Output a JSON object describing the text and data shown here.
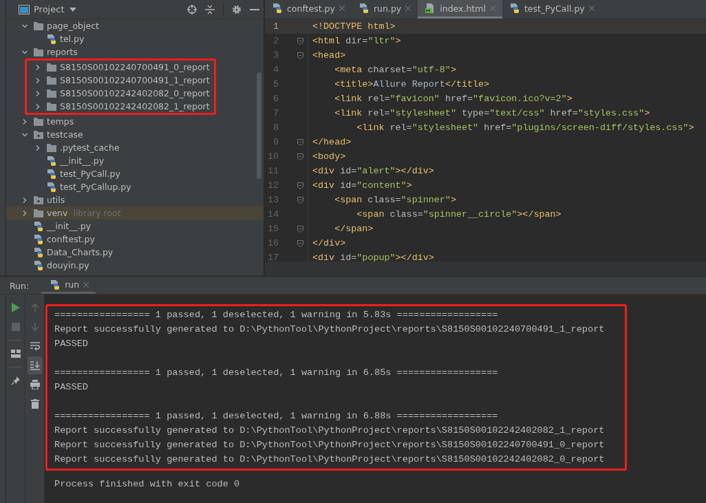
{
  "project_panel": {
    "title": "Project",
    "tree": [
      {
        "name": "page_object",
        "kind": "folder",
        "expanded": true,
        "selected": false,
        "children": [
          {
            "name": "tel.py",
            "kind": "python",
            "selected": false
          }
        ]
      },
      {
        "name": "reports",
        "kind": "folder",
        "expanded": true,
        "selected": false,
        "highlighted": true,
        "children": [
          {
            "name": "S8150S00102240700491_0_report",
            "kind": "folder",
            "expanded": false,
            "selected": false
          },
          {
            "name": "S8150S00102240700491_1_report",
            "kind": "folder",
            "expanded": false,
            "selected": false
          },
          {
            "name": "S8150S00102242402082_0_report",
            "kind": "folder",
            "expanded": false,
            "selected": false
          },
          {
            "name": "S8150S00102242402082_1_report",
            "kind": "folder",
            "expanded": false,
            "selected": false
          }
        ]
      },
      {
        "name": "temps",
        "kind": "folder",
        "expanded": false,
        "selected": false
      },
      {
        "name": "testcase",
        "kind": "package",
        "expanded": true,
        "selected": false,
        "children": [
          {
            "name": ".pytest_cache",
            "kind": "folder",
            "expanded": false,
            "selected": false
          },
          {
            "name": "__init__.py",
            "kind": "python",
            "selected": false
          },
          {
            "name": "test_PyCall.py",
            "kind": "python",
            "selected": false
          },
          {
            "name": "test_PyCallup.py",
            "kind": "python",
            "selected": false
          }
        ]
      },
      {
        "name": "utils",
        "kind": "package",
        "expanded": false,
        "selected": false
      },
      {
        "name": "venv",
        "kind": "folder",
        "expanded": false,
        "selected": true,
        "suffix": "library root"
      },
      {
        "name": "__init__.py",
        "kind": "python",
        "selected": false
      },
      {
        "name": "conftest.py",
        "kind": "python",
        "selected": false
      },
      {
        "name": "Data_Charts.py",
        "kind": "python",
        "selected": false
      },
      {
        "name": "douyin.py",
        "kind": "python",
        "selected": false
      }
    ]
  },
  "editor": {
    "tabs": [
      {
        "label": "conftest.py",
        "kind": "python",
        "selected": false
      },
      {
        "label": "run.py",
        "kind": "python",
        "selected": false
      },
      {
        "label": "index.html",
        "kind": "html",
        "selected": true
      },
      {
        "label": "test_PyCall.py",
        "kind": "python",
        "selected": false
      }
    ],
    "lines": [
      {
        "number": "1",
        "current": true,
        "fold": false,
        "tokens": [
          {
            "kind": "tag",
            "text": "<!DOCTYPE html>"
          }
        ]
      },
      {
        "number": "2",
        "current": false,
        "fold": true,
        "tokens": [
          {
            "kind": "tag",
            "text": "<html"
          },
          {
            "kind": "attr",
            "text": " dir="
          },
          {
            "kind": "value",
            "text": "\"ltr\""
          },
          {
            "kind": "tag",
            "text": ">"
          }
        ]
      },
      {
        "number": "3",
        "current": false,
        "fold": true,
        "tokens": [
          {
            "kind": "tag",
            "text": "<head>"
          }
        ]
      },
      {
        "number": "4",
        "current": false,
        "fold": false,
        "tokens": [
          {
            "kind": "tag",
            "text": "    <meta"
          },
          {
            "kind": "attr",
            "text": " charset="
          },
          {
            "kind": "value",
            "text": "\"utf-8\""
          },
          {
            "kind": "tag",
            "text": ">"
          }
        ]
      },
      {
        "number": "5",
        "current": false,
        "fold": false,
        "tokens": [
          {
            "kind": "tag",
            "text": "    <title>"
          },
          {
            "kind": "text",
            "text": "Allure Report"
          },
          {
            "kind": "tag",
            "text": "</title>"
          }
        ]
      },
      {
        "number": "6",
        "current": false,
        "fold": false,
        "tokens": [
          {
            "kind": "tag",
            "text": "    <link"
          },
          {
            "kind": "attr",
            "text": " rel="
          },
          {
            "kind": "value",
            "text": "\"favicon\""
          },
          {
            "kind": "attr",
            "text": " href="
          },
          {
            "kind": "value",
            "text": "\"favicon.ico?v=2\""
          },
          {
            "kind": "tag",
            "text": ">"
          }
        ]
      },
      {
        "number": "7",
        "current": false,
        "fold": false,
        "tokens": [
          {
            "kind": "tag",
            "text": "    <link"
          },
          {
            "kind": "attr",
            "text": " rel="
          },
          {
            "kind": "value",
            "text": "\"stylesheet\""
          },
          {
            "kind": "attr",
            "text": " type="
          },
          {
            "kind": "value",
            "text": "\"text/css\""
          },
          {
            "kind": "attr",
            "text": " href="
          },
          {
            "kind": "value",
            "text": "\"styles.css\""
          },
          {
            "kind": "tag",
            "text": ">"
          }
        ]
      },
      {
        "number": "8",
        "current": false,
        "fold": false,
        "tokens": [
          {
            "kind": "tag",
            "text": "        <link"
          },
          {
            "kind": "attr",
            "text": " rel="
          },
          {
            "kind": "value",
            "text": "\"stylesheet\""
          },
          {
            "kind": "attr",
            "text": " href="
          },
          {
            "kind": "value",
            "text": "\"plugins/screen-diff/styles.css\""
          },
          {
            "kind": "tag",
            "text": ">"
          }
        ]
      },
      {
        "number": "9",
        "current": false,
        "fold": true,
        "tokens": [
          {
            "kind": "tag",
            "text": "</head>"
          }
        ]
      },
      {
        "number": "10",
        "current": false,
        "fold": true,
        "tokens": [
          {
            "kind": "tag",
            "text": "<body>"
          }
        ]
      },
      {
        "number": "11",
        "current": false,
        "fold": false,
        "tokens": [
          {
            "kind": "tag",
            "text": "<div"
          },
          {
            "kind": "attr",
            "text": " id="
          },
          {
            "kind": "value",
            "text": "\"alert\""
          },
          {
            "kind": "tag",
            "text": "></div>"
          }
        ]
      },
      {
        "number": "12",
        "current": false,
        "fold": true,
        "tokens": [
          {
            "kind": "tag",
            "text": "<div"
          },
          {
            "kind": "attr",
            "text": " id="
          },
          {
            "kind": "value",
            "text": "\"content\""
          },
          {
            "kind": "tag",
            "text": ">"
          }
        ]
      },
      {
        "number": "13",
        "current": false,
        "fold": true,
        "tokens": [
          {
            "kind": "tag",
            "text": "    <span"
          },
          {
            "kind": "attr",
            "text": " class="
          },
          {
            "kind": "value",
            "text": "\"spinner\""
          },
          {
            "kind": "tag",
            "text": ">"
          }
        ]
      },
      {
        "number": "14",
        "current": false,
        "fold": false,
        "tokens": [
          {
            "kind": "tag",
            "text": "        <span"
          },
          {
            "kind": "attr",
            "text": " class="
          },
          {
            "kind": "value",
            "text": "\"spinner__circle\""
          },
          {
            "kind": "tag",
            "text": "></span>"
          }
        ]
      },
      {
        "number": "15",
        "current": false,
        "fold": true,
        "tokens": [
          {
            "kind": "tag",
            "text": "    </span>"
          }
        ]
      },
      {
        "number": "16",
        "current": false,
        "fold": true,
        "tokens": [
          {
            "kind": "tag",
            "text": "</div>"
          }
        ]
      },
      {
        "number": "17",
        "current": false,
        "fold": false,
        "tokens": [
          {
            "kind": "tag",
            "text": "<div"
          },
          {
            "kind": "attr",
            "text": " id="
          },
          {
            "kind": "value",
            "text": "\"popup\""
          },
          {
            "kind": "tag",
            "text": "></div>"
          }
        ]
      }
    ]
  },
  "run_panel": {
    "label": "Run:",
    "tab": {
      "label": "run"
    },
    "toolbar_left": [
      {
        "kind": "run"
      },
      {
        "kind": "stop"
      },
      {
        "kind": "layout"
      },
      {
        "kind": "pin"
      }
    ],
    "toolbar_right": [
      {
        "kind": "up",
        "on": false,
        "disabled": true
      },
      {
        "kind": "down",
        "on": false,
        "disabled": true
      },
      {
        "kind": "wrap",
        "on": false,
        "disabled": false
      },
      {
        "kind": "scroll_end",
        "on": true,
        "disabled": false
      },
      {
        "kind": "print",
        "on": false,
        "disabled": false
      },
      {
        "kind": "trash",
        "on": false,
        "disabled": false
      }
    ],
    "output_highlighted": true,
    "output_groups": [
      [
        "================= 1 passed, 1 deselected, 1 warning in 5.83s ==================",
        "Report successfully generated to D:\\PythonTool\\PythonProject\\reports\\S8150S00102240700491_1_report",
        "PASSED"
      ],
      [
        "================= 1 passed, 1 deselected, 1 warning in 6.85s ==================",
        "PASSED"
      ],
      [
        "================= 1 passed, 1 deselected, 1 warning in 6.88s ==================",
        "Report successfully generated to D:\\PythonTool\\PythonProject\\reports\\S8150S00102242402082_1_report",
        "Report successfully generated to D:\\PythonTool\\PythonProject\\reports\\S8150S00102240700491_0_report",
        "Report successfully generated to D:\\PythonTool\\PythonProject\\reports\\S8150S00102242402082_0_report"
      ]
    ],
    "exit_message": "Process finished with exit code 0"
  }
}
